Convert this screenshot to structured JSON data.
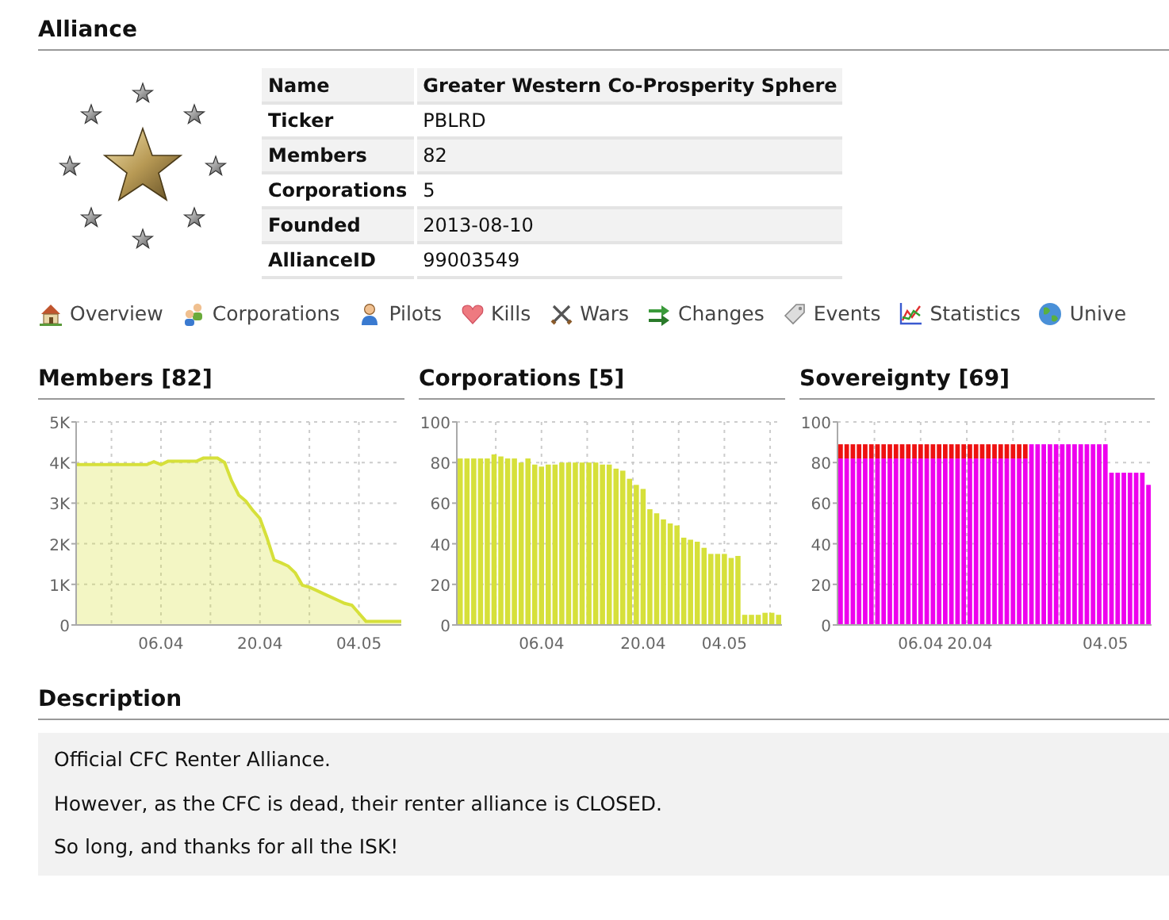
{
  "alliance": {
    "heading": "Alliance",
    "info": [
      {
        "label": "Name",
        "value": "Greater Western Co-Prosperity Sphere",
        "bold": true
      },
      {
        "label": "Ticker",
        "value": "PBLRD",
        "bold": false
      },
      {
        "label": "Members",
        "value": "82",
        "bold": false
      },
      {
        "label": "Corporations",
        "value": "5",
        "bold": false
      },
      {
        "label": "Founded",
        "value": "2013-08-10",
        "bold": false
      },
      {
        "label": "AllianceID",
        "value": "99003549",
        "bold": false
      }
    ]
  },
  "nav": [
    {
      "label": "Overview",
      "kind": "house"
    },
    {
      "label": "Corporations",
      "kind": "people"
    },
    {
      "label": "Pilots",
      "kind": "person"
    },
    {
      "label": "Kills",
      "kind": "heart"
    },
    {
      "label": "Wars",
      "kind": "swords"
    },
    {
      "label": "Changes",
      "kind": "arrows"
    },
    {
      "label": "Events",
      "kind": "tag"
    },
    {
      "label": "Statistics",
      "kind": "chart"
    },
    {
      "label": "Unive",
      "kind": "globe"
    }
  ],
  "charts": [
    {
      "heading": "Members [82]",
      "chart_data": {
        "type": "area",
        "categories": [
          null,
          null,
          null,
          null,
          null,
          null,
          null,
          null,
          null,
          null,
          null,
          null,
          "06.04",
          null,
          null,
          null,
          null,
          null,
          null,
          null,
          null,
          null,
          null,
          null,
          null,
          null,
          "20.04",
          null,
          null,
          null,
          null,
          null,
          null,
          null,
          null,
          null,
          null,
          null,
          null,
          null,
          "04.05",
          null,
          null,
          null,
          null,
          null,
          null
        ],
        "series": [
          {
            "color": "#d6e03a",
            "values": [
              3950,
              3950,
              3950,
              3950,
              3950,
              3950,
              3950,
              3950,
              3950,
              3950,
              3950,
              4020,
              3950,
              4030,
              4030,
              4030,
              4030,
              4030,
              4110,
              4110,
              4110,
              4000,
              3550,
              3200,
              3050,
              2820,
              2620,
              2150,
              1600,
              1530,
              1450,
              1280,
              980,
              930,
              850,
              770,
              690,
              610,
              530,
              490,
              290,
              90,
              90,
              90,
              90,
              90,
              90
            ]
          }
        ],
        "ylim": [
          0,
          5000
        ],
        "grid": true,
        "yticks": [
          {
            "value": 0,
            "label": "0"
          },
          {
            "value": 1000,
            "label": "1K"
          },
          {
            "value": 2000,
            "label": "2K"
          },
          {
            "value": 3000,
            "label": "3K"
          },
          {
            "value": 4000,
            "label": "4K"
          },
          {
            "value": 5000,
            "label": "5K"
          }
        ]
      }
    },
    {
      "heading": "Corporations [5]",
      "chart_data": {
        "type": "bar",
        "categories": [
          null,
          null,
          null,
          null,
          null,
          null,
          null,
          null,
          null,
          null,
          null,
          null,
          "06.04",
          null,
          null,
          null,
          null,
          null,
          null,
          null,
          null,
          null,
          null,
          null,
          null,
          null,
          null,
          "20.04",
          null,
          null,
          null,
          null,
          null,
          null,
          null,
          null,
          null,
          null,
          null,
          "04.05",
          null,
          null,
          null,
          null,
          null,
          null,
          null,
          null
        ],
        "grid": true,
        "series": [
          {
            "color": "#d6e03a",
            "values": [
              82,
              82,
              82,
              82,
              82,
              84,
              83,
              82,
              82,
              80,
              82,
              79,
              78,
              79,
              79,
              80,
              80,
              80,
              80,
              80,
              80,
              79,
              79,
              77,
              76,
              72,
              69,
              67,
              57,
              55,
              52,
              50,
              49,
              43,
              42,
              41,
              38,
              35,
              35,
              35,
              33,
              34,
              5,
              5,
              5,
              6,
              6,
              5
            ]
          }
        ],
        "ylim": [
          0,
          100
        ],
        "yticks": [
          0,
          20,
          40,
          60,
          80,
          100
        ]
      }
    },
    {
      "heading": "Sovereignty [69]",
      "chart_data": {
        "type": "bar",
        "stacked": true,
        "grid": true,
        "categories": [
          null,
          null,
          null,
          null,
          null,
          null,
          null,
          null,
          null,
          null,
          null,
          null,
          null,
          "06.04",
          null,
          null,
          null,
          null,
          null,
          null,
          null,
          "20.04",
          null,
          null,
          null,
          null,
          null,
          null,
          null,
          null,
          null,
          null,
          null,
          null,
          null,
          null,
          null,
          null,
          null,
          null,
          null,
          null,
          null,
          "04.05",
          null,
          null,
          null,
          null,
          null,
          null,
          null
        ],
        "series": [
          {
            "color": "#ee00ee",
            "values": [
              82,
              82,
              82,
              82,
              82,
              82,
              82,
              82,
              82,
              82,
              82,
              82,
              82,
              82,
              82,
              82,
              82,
              82,
              82,
              82,
              82,
              82,
              82,
              82,
              82,
              82,
              82,
              82,
              82,
              82,
              82,
              89,
              89,
              89,
              89,
              89,
              89,
              89,
              89,
              89,
              89,
              89,
              89,
              89,
              75,
              75,
              75,
              75,
              75,
              75,
              69
            ]
          },
          {
            "color": "#ee1111",
            "values": [
              7,
              7,
              7,
              7,
              7,
              7,
              7,
              7,
              7,
              7,
              7,
              7,
              7,
              7,
              7,
              7,
              7,
              7,
              7,
              7,
              7,
              7,
              7,
              7,
              7,
              7,
              7,
              7,
              7,
              7,
              7,
              0,
              0,
              0,
              0,
              0,
              0,
              0,
              0,
              0,
              0,
              0,
              0,
              0,
              0,
              0,
              0,
              0,
              0,
              0,
              0
            ]
          }
        ],
        "ylim": [
          0,
          100
        ],
        "yticks": [
          0,
          20,
          40,
          60,
          80,
          100
        ]
      }
    }
  ],
  "description": {
    "heading": "Description",
    "paragraphs": [
      "Official CFC Renter Alliance.",
      "However, as the CFC is dead, their renter alliance is CLOSED.",
      "So long, and thanks for all the ISK!"
    ]
  }
}
